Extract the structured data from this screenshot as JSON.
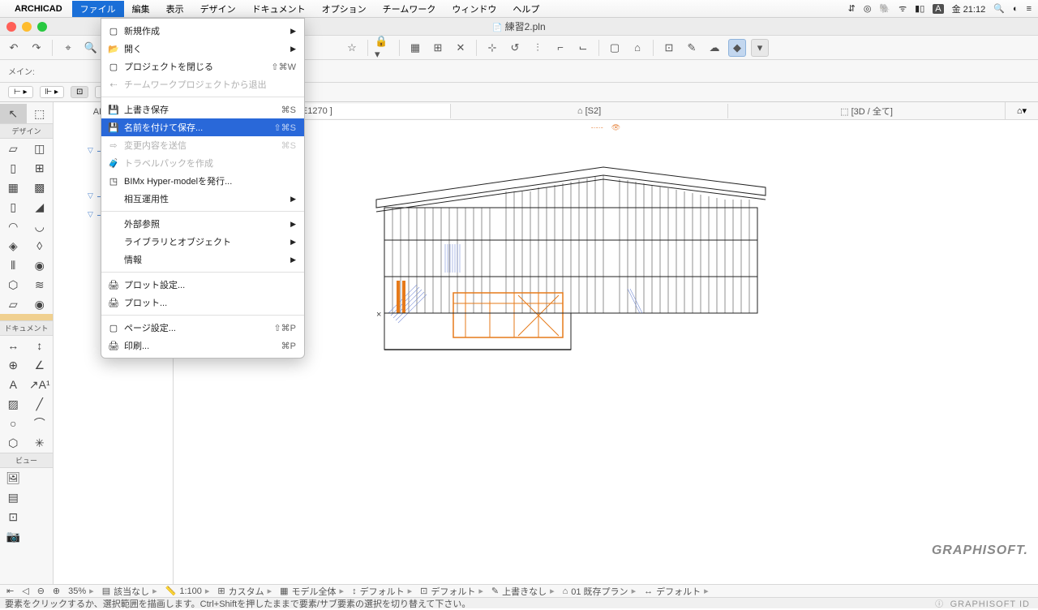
{
  "menubar": {
    "app": "ARCHICAD",
    "items": [
      "ファイル",
      "編集",
      "表示",
      "デザイン",
      "ドキュメント",
      "オプション",
      "チームワーク",
      "ウィンドウ",
      "ヘルプ"
    ],
    "activeIndex": 0,
    "clock": "金 21:12"
  },
  "window": {
    "title": "練習2.pln"
  },
  "dropdown": [
    {
      "icon": "▢",
      "label": "新規作成",
      "arrow": true
    },
    {
      "icon": "📂",
      "label": "開く",
      "arrow": true
    },
    {
      "icon": "▢",
      "label": "プロジェクトを閉じる",
      "shortcut": "⇧⌘W"
    },
    {
      "icon": "⇠",
      "label": "チームワークプロジェクトから退出",
      "disabled": true
    },
    {
      "divider": true
    },
    {
      "icon": "💾",
      "label": "上書き保存",
      "shortcut": "⌘S"
    },
    {
      "icon": "💾",
      "label": "名前を付けて保存...",
      "shortcut": "⇧⌘S",
      "highlight": true
    },
    {
      "icon": "⇨",
      "label": "変更内容を送信",
      "shortcut": "⌘S",
      "disabled": true
    },
    {
      "icon": "🧳",
      "label": "トラベルパックを作成",
      "disabled": true
    },
    {
      "icon": "◳",
      "label": "BIMx Hyper-modelを発行..."
    },
    {
      "label": "相互運用性",
      "arrow": true
    },
    {
      "divider": true
    },
    {
      "label": "外部参照",
      "arrow": true
    },
    {
      "label": "ライブラリとオブジェクト",
      "arrow": true
    },
    {
      "label": "情報",
      "arrow": true
    },
    {
      "divider": true
    },
    {
      "icon": "🖨",
      "label": "プロット設定..."
    },
    {
      "icon": "🖨",
      "label": "プロット..."
    },
    {
      "divider": true
    },
    {
      "icon": "▢",
      "label": "ページ設定...",
      "shortcut": "⇧⌘P"
    },
    {
      "icon": "🖨",
      "label": "印刷...",
      "shortcut": "⌘P"
    }
  ],
  "subtoolbar": {
    "label": "メイン:"
  },
  "toolbox": {
    "sections": [
      "デザイン",
      "ドキュメント",
      "ビュー"
    ]
  },
  "panel": {
    "header": "ARCHICA"
  },
  "viewtabs": {
    "tabs": [
      {
        "icon": "⌂",
        "label": "[E1270 ]",
        "active": true
      },
      {
        "icon": "⌂",
        "label": "[S2]"
      },
      {
        "icon": "⬚",
        "label": "[3D / 全て]"
      }
    ]
  },
  "statusbar": {
    "zoom": "35%",
    "s1": "該当なし",
    "s2": "1:100",
    "s3": "カスタム",
    "s4": "モデル全体",
    "s5": "デフォルト",
    "s6": "デフォルト",
    "s7": "上書きなし",
    "s8": "01 既存プラン",
    "s9": "デフォルト"
  },
  "hint": "要素をクリックするか、選択範囲を描画します。Ctrl+Shiftを押したままで要素/サブ要素の選択を切り替えて下さい。",
  "brand": "GRAPHISOFT.",
  "brandid": "GRAPHISOFT ID"
}
